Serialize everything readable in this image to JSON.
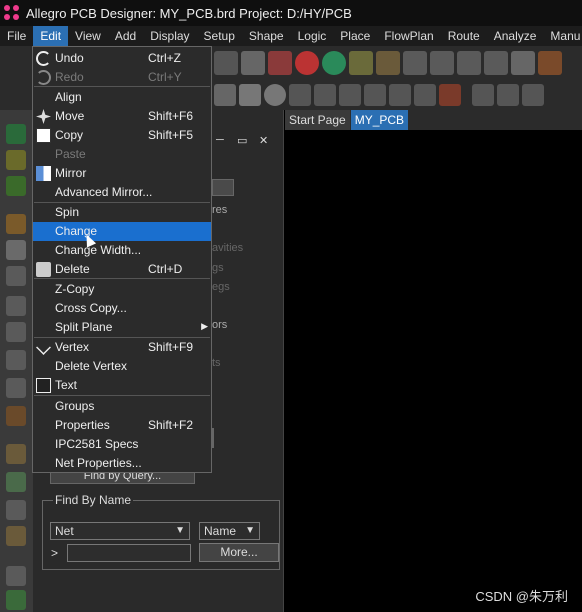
{
  "window": {
    "title": "Allegro PCB Designer: MY_PCB.brd  Project: D:/HY/PCB"
  },
  "menubar": {
    "items": [
      "File",
      "Edit",
      "View",
      "Add",
      "Display",
      "Setup",
      "Shape",
      "Logic",
      "Place",
      "FlowPlan",
      "Route",
      "Analyze",
      "Manu"
    ],
    "active": "Edit"
  },
  "edit_menu": {
    "items": [
      {
        "label": "Undo",
        "shortcut": "Ctrl+Z",
        "icon": "undo-icon",
        "disabled": false
      },
      {
        "label": "Redo",
        "shortcut": "Ctrl+Y",
        "icon": "redo-icon",
        "disabled": true
      },
      {
        "label": "Align",
        "shortcut": "",
        "icon": "",
        "disabled": false
      },
      {
        "label": "Move",
        "shortcut": "Shift+F6",
        "icon": "move-icon",
        "disabled": false
      },
      {
        "label": "Copy",
        "shortcut": "Shift+F5",
        "icon": "copy-icon",
        "disabled": false
      },
      {
        "label": "Paste",
        "shortcut": "",
        "icon": "",
        "disabled": true
      },
      {
        "label": "Mirror",
        "shortcut": "",
        "icon": "mirror-icon",
        "disabled": false
      },
      {
        "label": "Advanced Mirror...",
        "shortcut": "",
        "icon": "",
        "disabled": false
      },
      {
        "label": "Spin",
        "shortcut": "",
        "icon": "",
        "disabled": false
      },
      {
        "label": "Change",
        "shortcut": "",
        "icon": "",
        "disabled": false
      },
      {
        "label": "Change Width...",
        "shortcut": "",
        "icon": "",
        "disabled": false
      },
      {
        "label": "Delete",
        "shortcut": "Ctrl+D",
        "icon": "delete-icon",
        "disabled": false
      },
      {
        "label": "Z-Copy",
        "shortcut": "",
        "icon": "",
        "disabled": false
      },
      {
        "label": "Cross Copy...",
        "shortcut": "",
        "icon": "",
        "disabled": false
      },
      {
        "label": "Split Plane",
        "shortcut": "",
        "icon": "",
        "disabled": false
      },
      {
        "label": "Vertex",
        "shortcut": "Shift+F9",
        "icon": "vertex-icon",
        "disabled": false
      },
      {
        "label": "Delete Vertex",
        "shortcut": "",
        "icon": "",
        "disabled": false
      },
      {
        "label": "Text",
        "shortcut": "",
        "icon": "text-icon",
        "disabled": false
      },
      {
        "label": "Groups",
        "shortcut": "",
        "icon": "",
        "disabled": false
      },
      {
        "label": "Properties",
        "shortcut": "Shift+F2",
        "icon": "",
        "disabled": false
      },
      {
        "label": "IPC2581 Specs",
        "shortcut": "",
        "icon": "",
        "disabled": false
      },
      {
        "label": "Net Properties...",
        "shortcut": "",
        "icon": "",
        "disabled": false
      }
    ],
    "highlighted": "Change",
    "submenu_item": "Split Plane"
  },
  "tabs": {
    "items": [
      "Start Page",
      "MY_PCB"
    ],
    "active": "MY_PCB"
  },
  "options_panel": {
    "partial_labels": [
      "res",
      "avities",
      "gs",
      "egs",
      "ors",
      "ts"
    ],
    "find_by_query_label": "Find by Query...",
    "find_by_name": {
      "title": "Find By Name",
      "type_select": "Net",
      "mode_select": "Name",
      "prompt": ">",
      "more_button": "More..."
    }
  },
  "watermark": "CSDN @朱万利",
  "colors": {
    "menu_highlight": "#1a6fcf",
    "active_tab": "#2b6fb3",
    "canvas": "#000000",
    "panel": "#2a2a2a"
  }
}
